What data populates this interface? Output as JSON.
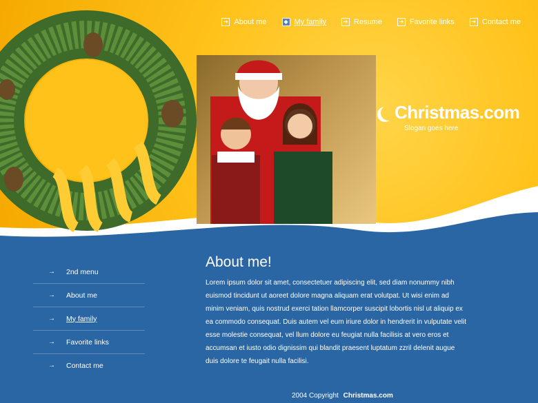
{
  "top_nav": [
    {
      "label": "About me",
      "active": false
    },
    {
      "label": "My family",
      "active": true
    },
    {
      "label": "Resume",
      "active": false
    },
    {
      "label": "Favorite links",
      "active": false
    },
    {
      "label": "Contact me",
      "active": false
    }
  ],
  "logo": {
    "brand": "Christmas.com",
    "slogan": "Slogan goes here"
  },
  "left_menu": [
    {
      "label": "2nd menu",
      "active": false
    },
    {
      "label": "About me",
      "active": false
    },
    {
      "label": "My family",
      "active": true
    },
    {
      "label": "Favorite links",
      "active": false
    },
    {
      "label": "Contact me",
      "active": false
    }
  ],
  "content": {
    "title": "About me!",
    "body": "Lorem ipsum dolor sit amet, consectetuer adipiscing elit, sed diam nonummy nibh euismod tincidunt ut aoreet dolore magna aliquam erat volutpat. Ut wisi enim ad minim veniam, quis nostrud exerci tation llamcorper suscipit lobortis nisl ut aliquip ex ea commodo consequat. Duis autem vel eum iriure dolor in hendrerit in vulputate velit esse molestie consequat, vel llum dolore eu feugiat nulla facilisis at vero eros et accumsan et iusto odio dignissim qui blandit praesent luptatum zzril delenit augue duis dolore te feugait nulla facilisi."
  },
  "footer": {
    "copyright": "2004 Copyright",
    "brand": "Christmas.com"
  },
  "colors": {
    "gold": "#ffc21a",
    "blue": "#2b66a4"
  }
}
